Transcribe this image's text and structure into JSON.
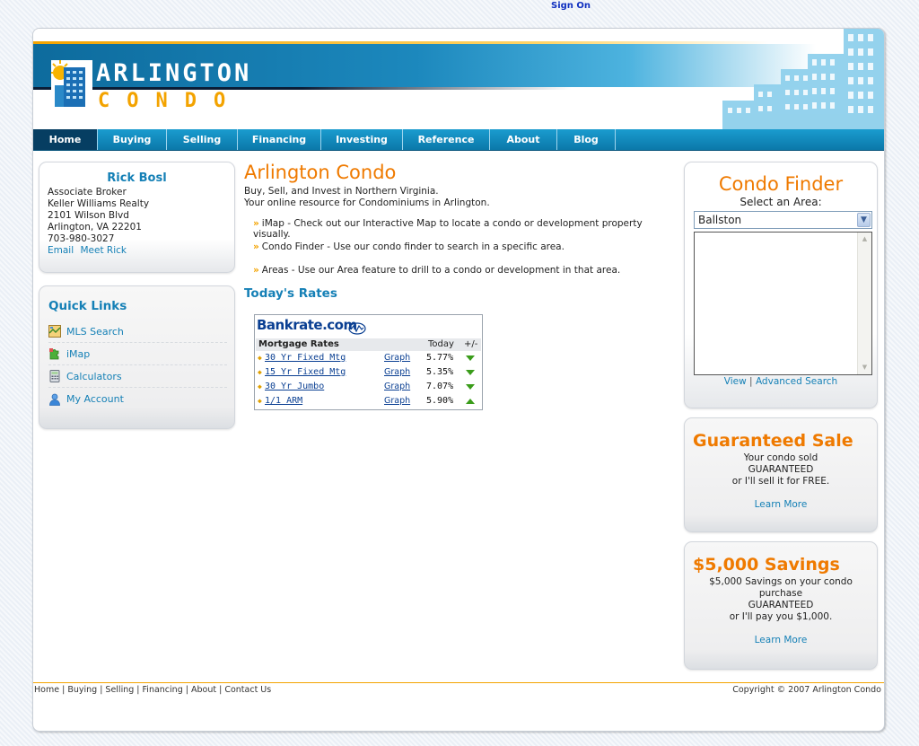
{
  "top": {
    "sign_on": "Sign On"
  },
  "logo": {
    "line1": "ARLINGTON",
    "line2": "CONDO"
  },
  "nav": [
    "Home",
    "Buying",
    "Selling",
    "Financing",
    "Investing",
    "Reference",
    "About",
    "Blog"
  ],
  "contact": {
    "name": "Rick Bosl",
    "title": "Associate Broker",
    "company": "Keller Williams Realty",
    "street": "2101 Wilson Blvd",
    "city": "Arlington, VA 22201",
    "phone": "703-980-3027",
    "email_link": "Email",
    "meet_link": "Meet Rick"
  },
  "quick_links": {
    "title": "Quick Links",
    "items": [
      {
        "label": "MLS Search",
        "icon": "map-icon"
      },
      {
        "label": "iMap",
        "icon": "puzzle-icon"
      },
      {
        "label": "Calculators",
        "icon": "calculator-icon"
      },
      {
        "label": "My Account",
        "icon": "user-icon"
      }
    ]
  },
  "main": {
    "title": "Arlington Condo",
    "intro1": "Buy, Sell, and Invest in Northern Virginia.",
    "intro2": "Your online resource for Condominiums in Arlington.",
    "bullets": [
      "iMap - Check out our Interactive Map to locate a condo or development property visually.",
      "Condo Finder - Use our condo finder to search in a specific area.",
      "Areas - Use our Area feature to drill to a condo or development in that area."
    ],
    "rates_title": "Today's Rates"
  },
  "rates": {
    "brand": "Bankrate.com",
    "header_label": "Mortgage Rates",
    "header_today": "Today",
    "header_change": "+/-",
    "rows": [
      {
        "product": "30 Yr Fixed Mtg",
        "graph": "Graph",
        "rate": "5.77%",
        "trend": "down"
      },
      {
        "product": "15 Yr Fixed Mtg",
        "graph": "Graph",
        "rate": "5.35%",
        "trend": "down"
      },
      {
        "product": "30 Yr Jumbo",
        "graph": "Graph",
        "rate": "7.07%",
        "trend": "down"
      },
      {
        "product": "1/1 ARM",
        "graph": "Graph",
        "rate": "5.90%",
        "trend": "up"
      }
    ]
  },
  "finder": {
    "title": "Condo Finder",
    "subtitle": "Select an Area:",
    "selected_area": "Ballston",
    "view_link": "View",
    "separator": "|",
    "advanced_link": "Advanced Search"
  },
  "promo1": {
    "title": "Guaranteed Sale",
    "line1": "Your condo sold",
    "line2": "GUARANTEED",
    "line3": "or I'll sell it for FREE.",
    "link": "Learn More"
  },
  "promo2": {
    "title": "$5,000 Savings",
    "line1": "$5,000 Savings on your condo",
    "line2": "purchase",
    "line3": "GUARANTEED",
    "line4": "or I'll pay you $1,000.",
    "link": "Learn More"
  },
  "footer": {
    "links": [
      "Home",
      "Buying",
      "Selling",
      "Financing",
      "About",
      "Contact Us"
    ],
    "copyright": "Copyright © 2007 Arlington Condo"
  },
  "colors": {
    "accent_orange": "#ef7a00",
    "accent_blue": "#1580b6",
    "nav_blue": "#0b78a9",
    "nav_active": "#063e62"
  }
}
